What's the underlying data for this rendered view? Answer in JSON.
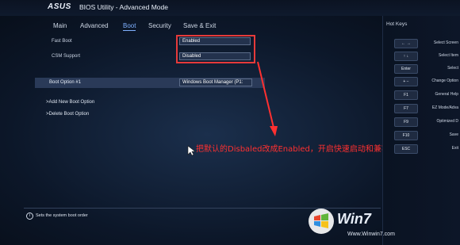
{
  "header": {
    "logo": "ASUS",
    "title": "BIOS Utility - Advanced Mode"
  },
  "tabs": [
    {
      "label": "Main"
    },
    {
      "label": "Advanced"
    },
    {
      "label": "Boot",
      "active": true
    },
    {
      "label": "Security"
    },
    {
      "label": "Save & Exit"
    }
  ],
  "settings": {
    "fast_boot": {
      "label": "Fast Boot",
      "value": "Enabled"
    },
    "csm_support": {
      "label": "CSM Support",
      "value": "Disabled"
    },
    "boot_option_1": {
      "label": "Boot Option #1",
      "value": "Windows Boot Manager (P1:"
    }
  },
  "actions": {
    "add": "Add New Boot Option",
    "delete": "Delete Boot Option"
  },
  "help": {
    "icon": "info-icon",
    "text": "Sets the system boot order"
  },
  "hotkeys": {
    "title": "Hot Keys",
    "items": [
      {
        "key": "← →",
        "desc": "Select Screen"
      },
      {
        "key": "↑ ↓",
        "desc": "Select Item"
      },
      {
        "key": "Enter",
        "desc": "Select"
      },
      {
        "key": "+ −",
        "desc": "Change Option"
      },
      {
        "key": "F1",
        "desc": "General Help"
      },
      {
        "key": "F7",
        "desc": "EZ Mode/Adva"
      },
      {
        "key": "F9",
        "desc": "Optimized D"
      },
      {
        "key": "F10",
        "desc": "Save"
      },
      {
        "key": "ESC",
        "desc": "Exit"
      }
    ]
  },
  "annotation": {
    "text": "把默认的Disbaled改成Enabled，开启快速启动和兼容模式",
    "color": "#ff3030"
  },
  "watermark": {
    "text": "Win7",
    "url": "Www.Winwin7.com"
  },
  "colors": {
    "accent": "#7fb0ff",
    "highlight": "#e63a3a"
  }
}
